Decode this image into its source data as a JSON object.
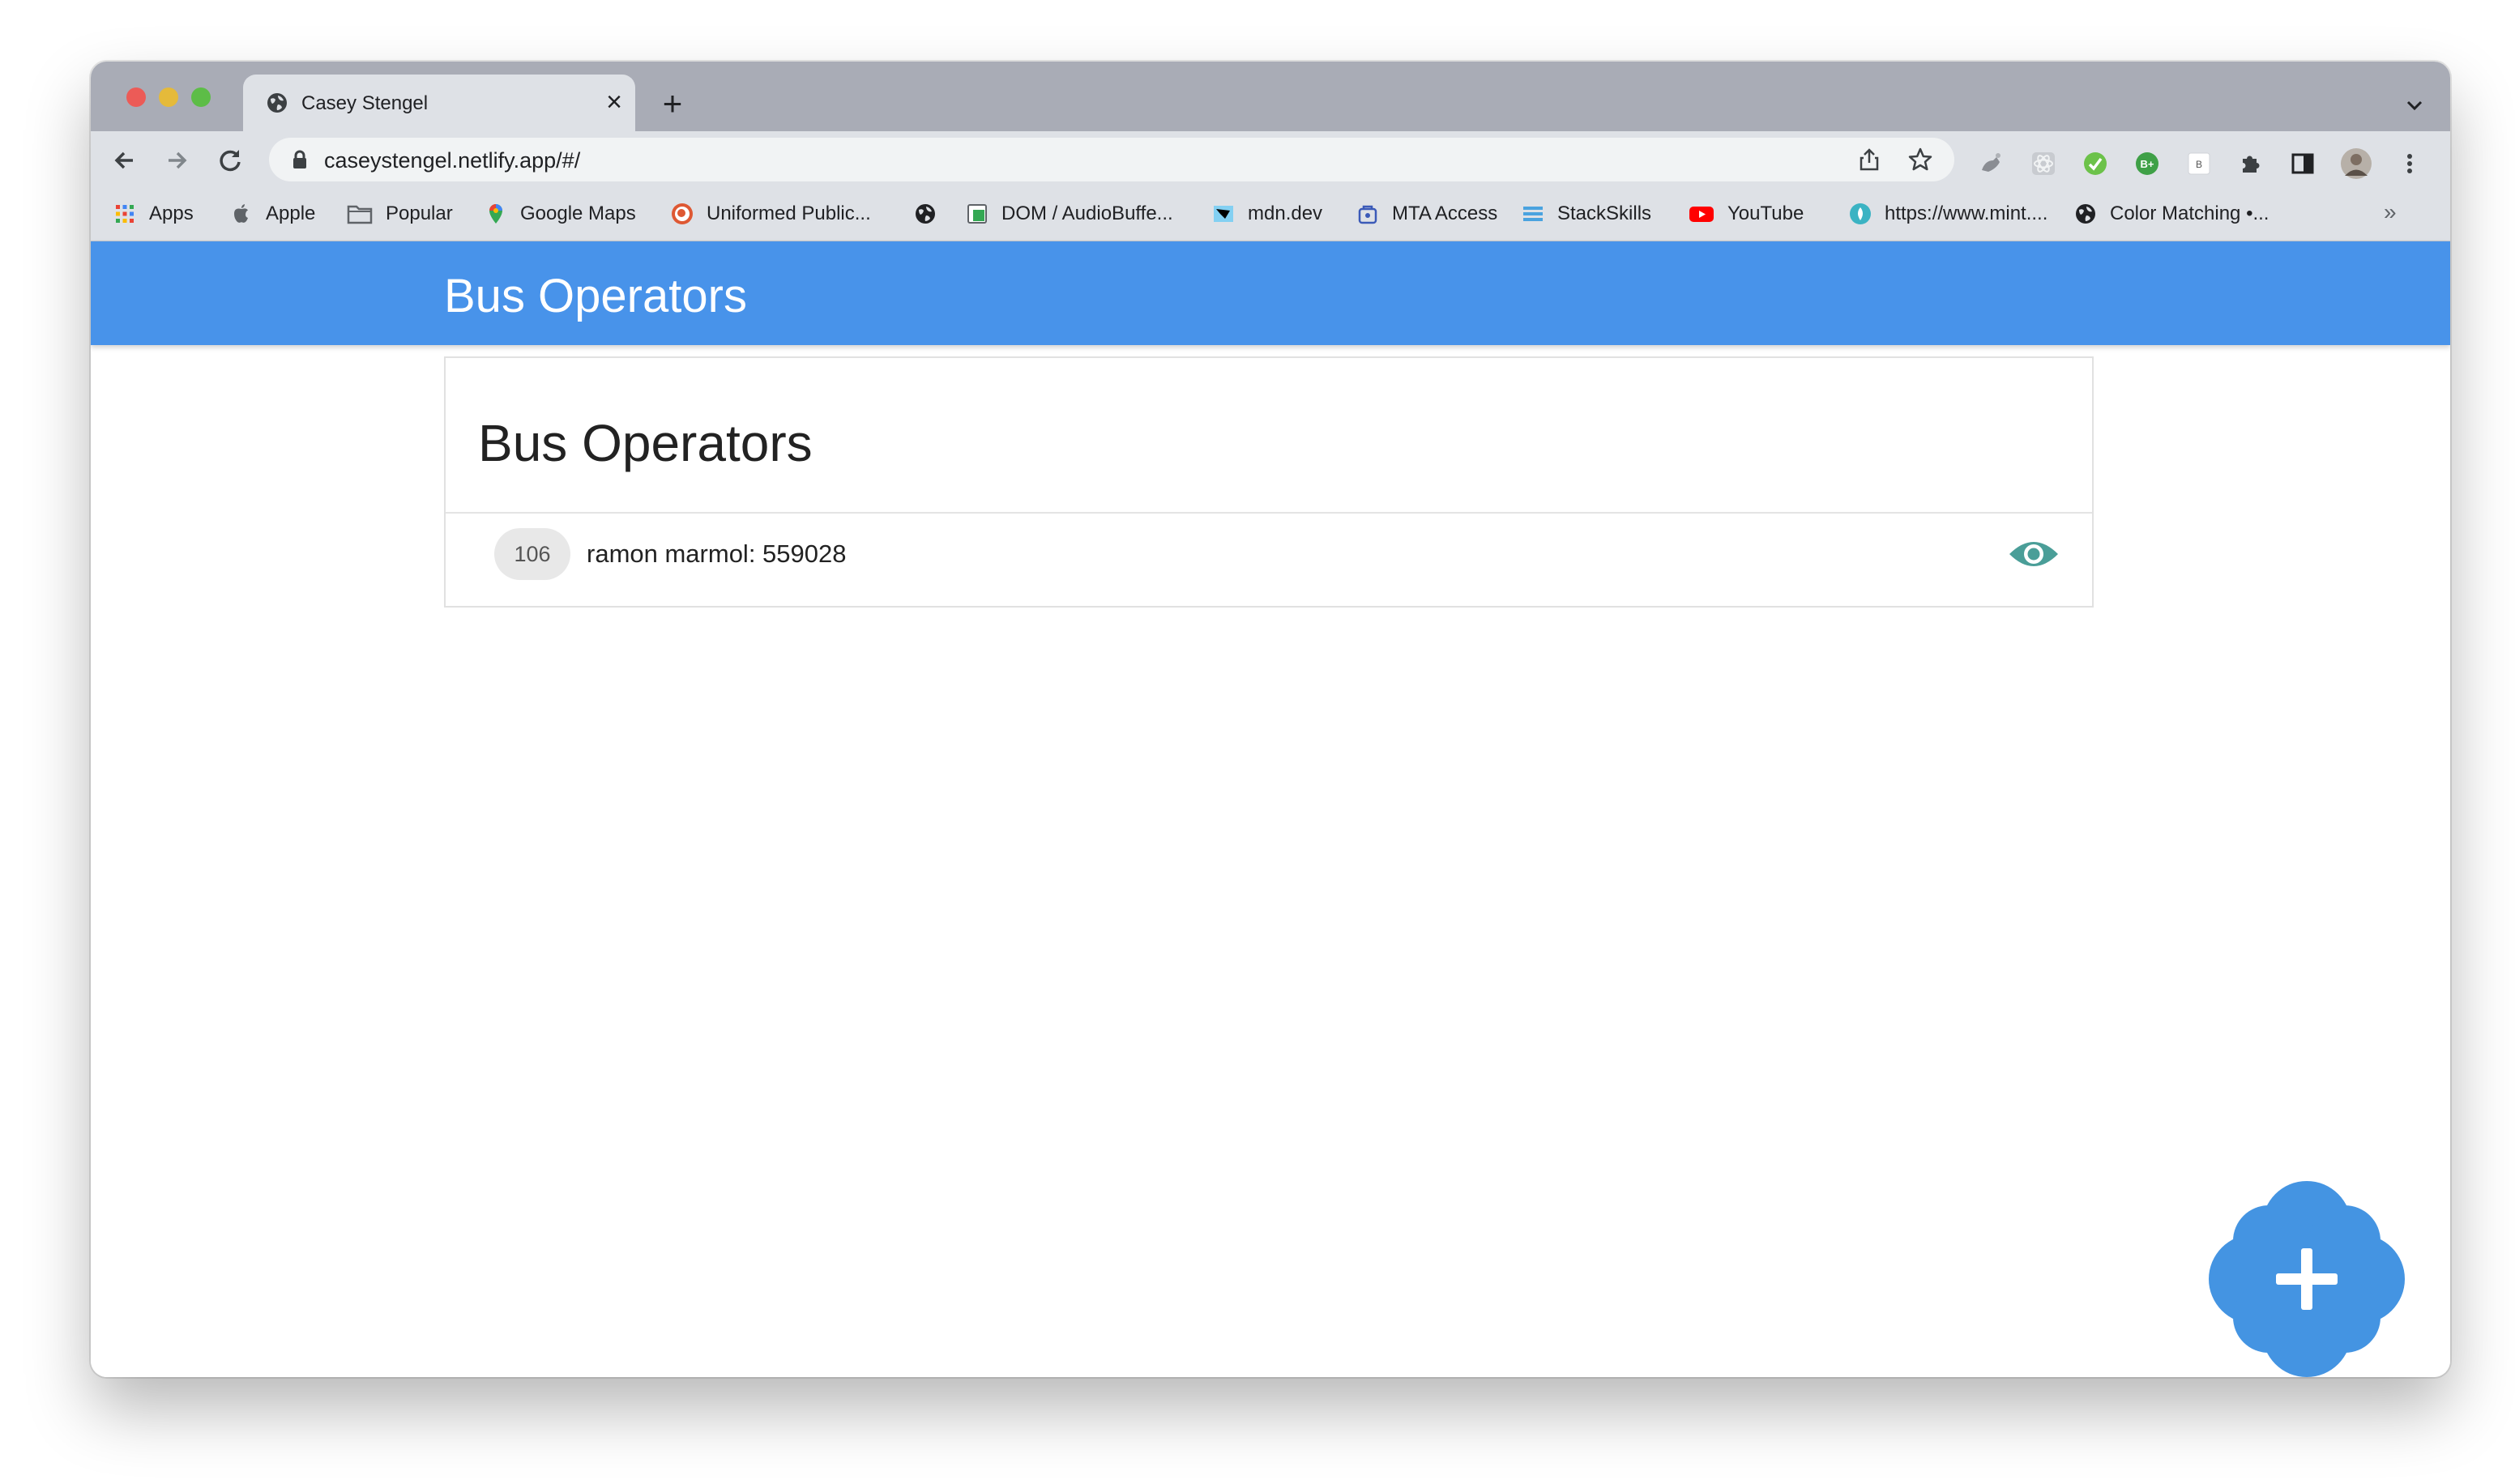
{
  "browser": {
    "tab_title": "Casey Stengel",
    "new_tab_symbol": "+",
    "close_symbol": "×",
    "url": "caseystengel.netlify.app/#/",
    "bookmarks": [
      {
        "label": "Apps",
        "icon": "apps-grid-icon"
      },
      {
        "label": "Apple",
        "icon": "apple-icon"
      },
      {
        "label": "Popular",
        "icon": "folder-icon"
      },
      {
        "label": "Google Maps",
        "icon": "maps-pin-icon"
      },
      {
        "label": "Uniformed Public...",
        "icon": "duckduckgo-icon"
      },
      {
        "label": "",
        "icon": "globe-icon"
      },
      {
        "label": "DOM / AudioBuffe...",
        "icon": "doc-icon"
      },
      {
        "label": "mdn.dev",
        "icon": "mdn-icon"
      },
      {
        "label": "MTA Access",
        "icon": "mta-icon"
      },
      {
        "label": "StackSkills",
        "icon": "stackskills-icon"
      },
      {
        "label": "YouTube",
        "icon": "youtube-icon"
      },
      {
        "label": "https://www.mint....",
        "icon": "mint-icon"
      },
      {
        "label": "Color Matching •...",
        "icon": "globe-icon"
      }
    ],
    "bookmarks_more": "»",
    "extensions": [
      {
        "icon": "extension-gray-icon"
      },
      {
        "icon": "react-devtools-icon"
      },
      {
        "icon": "green-check-extension-icon"
      },
      {
        "icon": "b-plus-extension-icon"
      },
      {
        "icon": "b-square-extension-icon"
      },
      {
        "icon": "puzzle-extensions-icon"
      },
      {
        "icon": "side-panel-icon"
      },
      {
        "icon": "profile-avatar-icon"
      },
      {
        "icon": "kebab-menu-icon"
      }
    ]
  },
  "app": {
    "header_title": "Bus Operators",
    "card_title": "Bus Operators",
    "operators": [
      {
        "badge": "106",
        "text": "ramon marmol: 559028"
      }
    ],
    "fab_symbol": "+",
    "colors": {
      "header": "#4893ea",
      "fab": "#4494e2",
      "eye": "#4a9e98"
    }
  }
}
